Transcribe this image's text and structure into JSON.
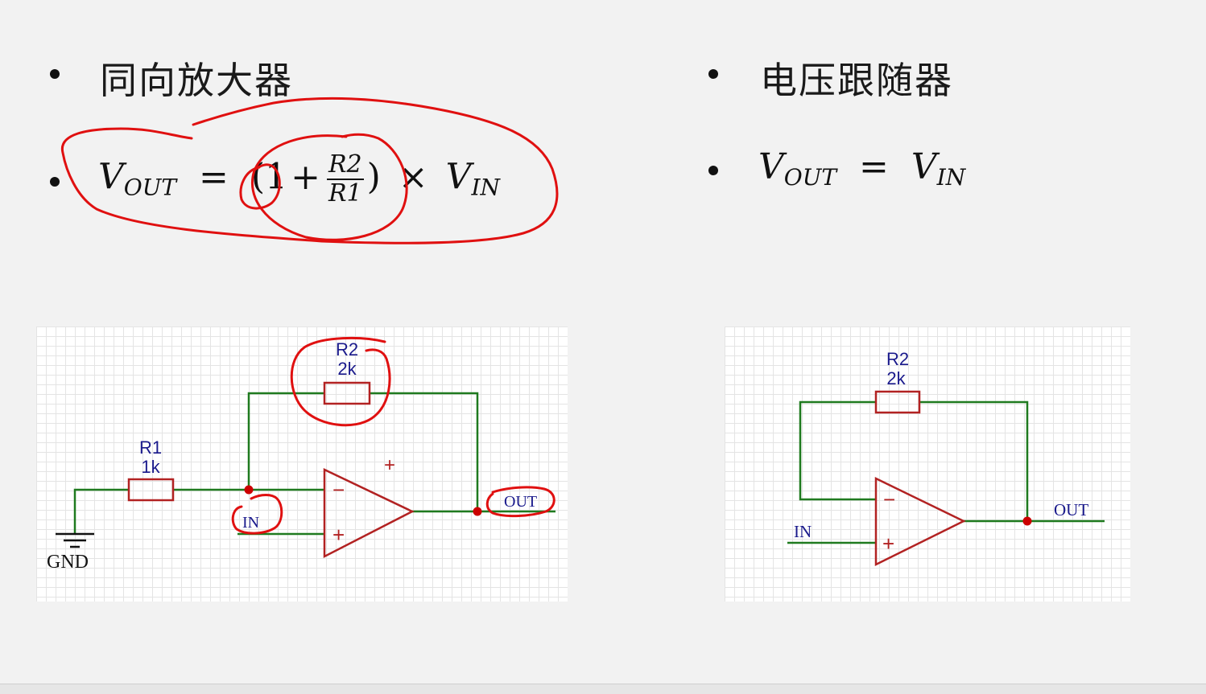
{
  "left": {
    "title": "同向放大器",
    "formula": {
      "lhs_v": "V",
      "lhs_sub": "OUT",
      "eq": "=",
      "open": "(",
      "one": "1",
      "plus": "+",
      "num": "R2",
      "den": "R1",
      "close": ")",
      "times": "×",
      "rhs_v": "V",
      "rhs_sub": "IN"
    },
    "circuit": {
      "r1_name": "R1",
      "r1_value": "1k",
      "r2_name": "R2",
      "r2_value": "2k",
      "minus": "−",
      "plus": "+",
      "extra_plus": "+",
      "in_label": "IN",
      "out_label": "OUT",
      "gnd_label": "GND"
    }
  },
  "right": {
    "title": "电压跟随器",
    "formula": {
      "lhs_v": "V",
      "lhs_sub": "OUT",
      "eq": "=",
      "rhs_v": "V",
      "rhs_sub": "IN"
    },
    "circuit": {
      "r2_name": "R2",
      "r2_value": "2k",
      "minus": "−",
      "plus": "+",
      "in_label": "IN",
      "out_label": "OUT"
    }
  },
  "colors": {
    "wire": "#1f7a1f",
    "component": "#b22222",
    "label": "#1a1a8c",
    "annotation": "#e01010"
  }
}
